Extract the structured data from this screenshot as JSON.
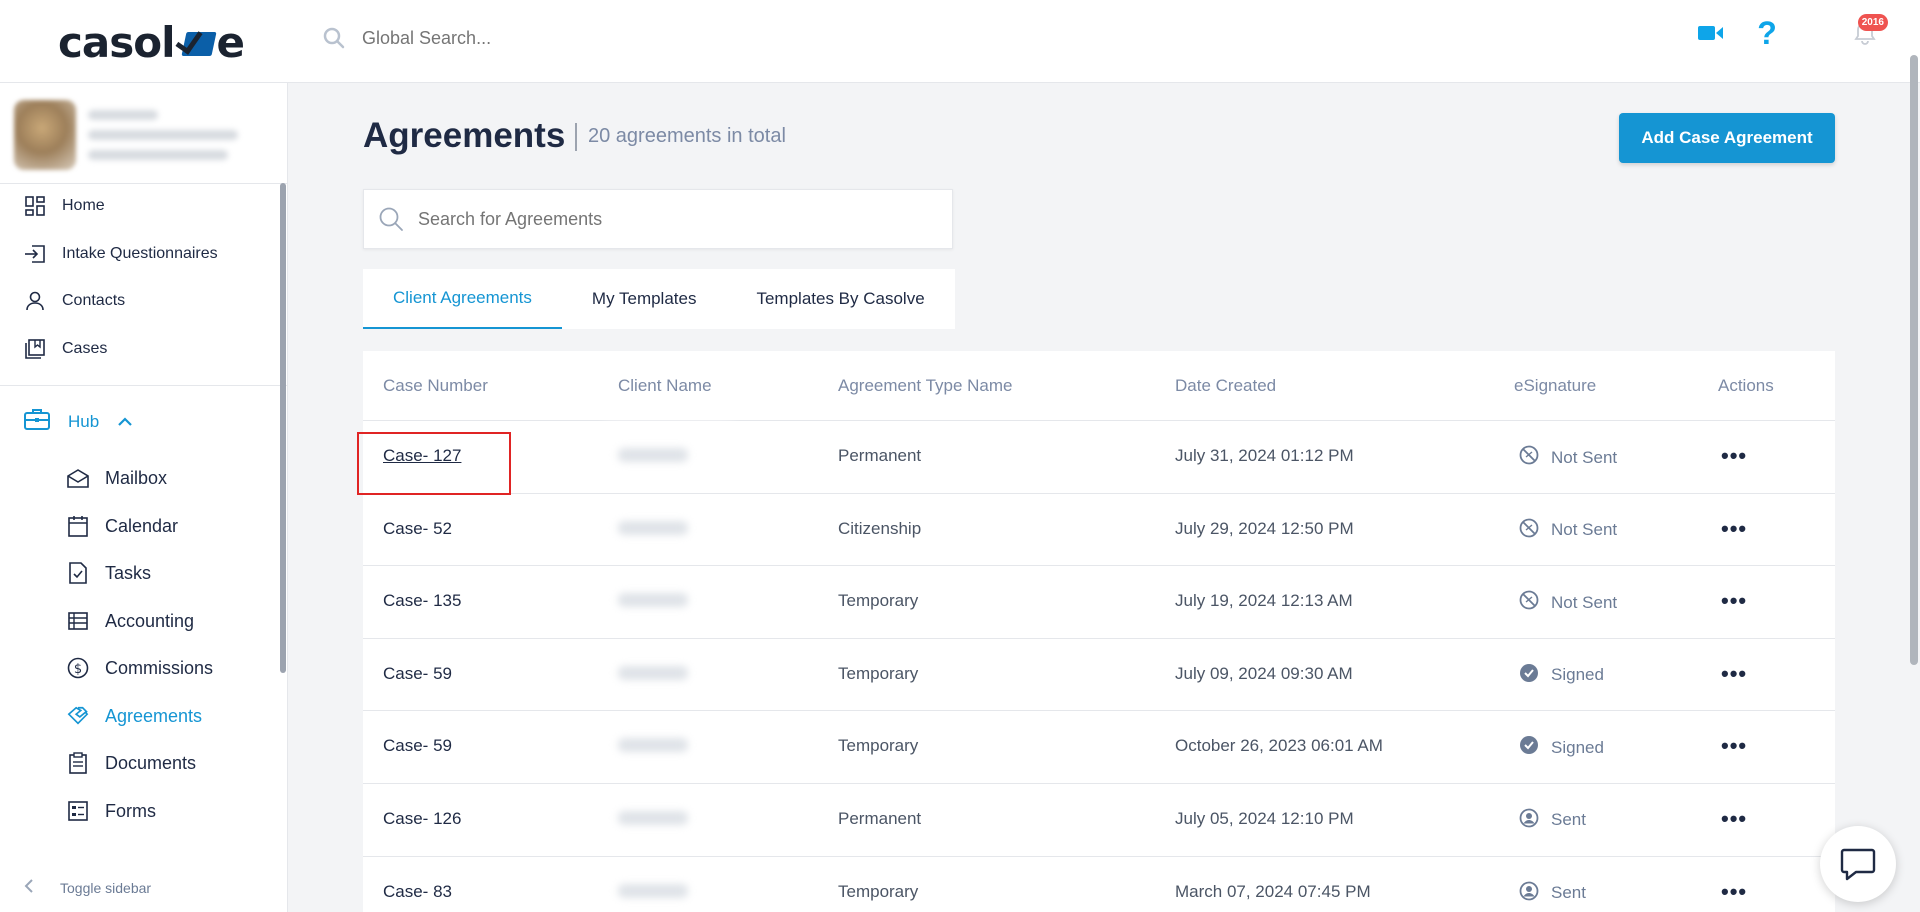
{
  "header": {
    "logo_text": "casolve",
    "search_placeholder": "Global Search...",
    "notification_count": "2016",
    "icons": [
      "video-icon",
      "help-icon",
      "bell-icon"
    ]
  },
  "sidebar": {
    "items": [
      {
        "label": "Home",
        "icon": "home-grid-icon"
      },
      {
        "label": "Intake Questionnaires",
        "icon": "intake-icon"
      },
      {
        "label": "Contacts",
        "icon": "person-icon"
      },
      {
        "label": "Cases",
        "icon": "cases-icon"
      }
    ],
    "hub": {
      "label": "Hub",
      "icon": "briefcase-icon",
      "expanded": true
    },
    "hub_items": [
      {
        "label": "Mailbox",
        "icon": "mailbox-icon"
      },
      {
        "label": "Calendar",
        "icon": "calendar-icon"
      },
      {
        "label": "Tasks",
        "icon": "tasks-icon"
      },
      {
        "label": "Accounting",
        "icon": "accounting-icon"
      },
      {
        "label": "Commissions",
        "icon": "dollar-icon"
      },
      {
        "label": "Agreements",
        "icon": "handshake-icon",
        "active": true
      },
      {
        "label": "Documents",
        "icon": "clipboard-icon"
      },
      {
        "label": "Forms",
        "icon": "forms-icon"
      }
    ],
    "toggle_label": "Toggle sidebar"
  },
  "main": {
    "title": "Agreements",
    "total": "20 agreements in total",
    "add_button": "Add Case Agreement",
    "search_placeholder": "Search for Agreements",
    "tabs": [
      {
        "label": "Client Agreements",
        "selected": true
      },
      {
        "label": "My Templates",
        "selected": false
      },
      {
        "label": "Templates By Casolve",
        "selected": false
      }
    ],
    "table": {
      "headers": [
        "Case Number",
        "Client Name",
        "Agreement Type Name",
        "Date Created",
        "eSignature",
        "Actions"
      ],
      "rows": [
        {
          "case": "Case- 127",
          "type": "Permanent",
          "date": "July 31, 2024 01:12 PM",
          "esig": "Not Sent"
        },
        {
          "case": "Case- 52",
          "type": "Citizenship",
          "date": "July 29, 2024 12:50 PM",
          "esig": "Not Sent"
        },
        {
          "case": "Case- 135",
          "type": "Temporary",
          "date": "July 19, 2024 12:13 AM",
          "esig": "Not Sent"
        },
        {
          "case": "Case- 59",
          "type": "Temporary",
          "date": "July 09, 2024 09:30 AM",
          "esig": "Signed"
        },
        {
          "case": "Case- 59",
          "type": "Temporary",
          "date": "October 26, 2023 06:01 AM",
          "esig": "Signed"
        },
        {
          "case": "Case- 126",
          "type": "Permanent",
          "date": "July 05, 2024 12:10 PM",
          "esig": "Sent"
        },
        {
          "case": "Case- 83",
          "type": "Temporary",
          "date": "March 07, 2024 07:45 PM",
          "esig": "Sent"
        }
      ]
    }
  },
  "colors": {
    "accent": "#1595d3",
    "text": "#1f2a44",
    "muted": "#7c8aa5",
    "highlight": "#e02424",
    "badge": "#ef5350"
  }
}
